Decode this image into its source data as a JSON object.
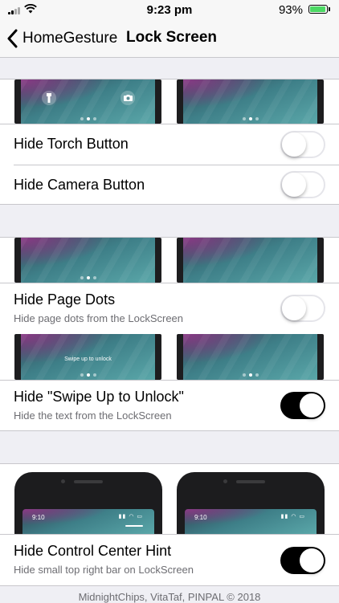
{
  "status_bar": {
    "time": "9:23 pm",
    "battery": "93%",
    "battery_level": 0.93
  },
  "nav": {
    "back_label": "HomeGesture",
    "title": "Lock Screen"
  },
  "section1": {
    "preview_icons": [
      "torch-icon",
      "camera-icon"
    ],
    "rows": [
      {
        "label": "Hide Torch Button",
        "toggle": "off"
      },
      {
        "label": "Hide Camera Button",
        "toggle": "off"
      }
    ]
  },
  "section2": {
    "page_dots": {
      "label": "Hide Page Dots",
      "sub": "Hide page dots from the LockScreen",
      "toggle": "off"
    },
    "swipe_preview_text": "Swipe up to unlock",
    "swipe": {
      "label": "Hide \"Swipe Up to Unlock\"",
      "sub": "Hide the text from the LockScreen",
      "toggle": "on"
    }
  },
  "section3": {
    "preview_time": "9:10",
    "hint": {
      "label": "Hide Control Center Hint",
      "sub": "Hide small top right bar on LockScreen",
      "toggle": "on"
    }
  },
  "footer": "MidnightChips, VitaTaf, PINPAL © 2018",
  "colors": {
    "toggle_on": "#000000",
    "battery": "#4cd964",
    "group_bg": "#efeff4"
  }
}
